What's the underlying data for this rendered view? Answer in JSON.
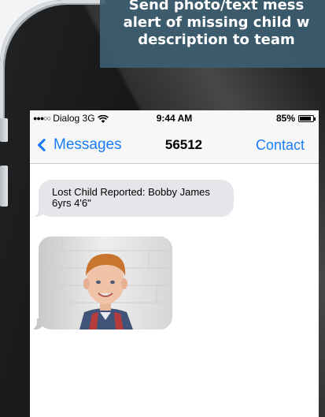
{
  "caption": {
    "lines": [
      "Send photo/text mess",
      "alert of missing child w",
      "description to team"
    ]
  },
  "status_bar": {
    "carrier": "Dialog 3G",
    "time": "9:44 AM",
    "battery": "85%",
    "battery_level": 0.85
  },
  "nav": {
    "back_label": "Messages",
    "title": "56512",
    "action_label": "Contact"
  },
  "messages": [
    {
      "text": "Lost Child Reported: Bobby James 6yrs 4'6\""
    }
  ],
  "icons": {
    "back": "chevron-left-icon",
    "wifi": "wifi-icon",
    "battery": "battery-icon",
    "signal": "signal-dots-icon"
  },
  "colors": {
    "accent": "#1a7cf3",
    "caption_bg": "#3c5d70",
    "bubble": "#e5e5ea"
  }
}
